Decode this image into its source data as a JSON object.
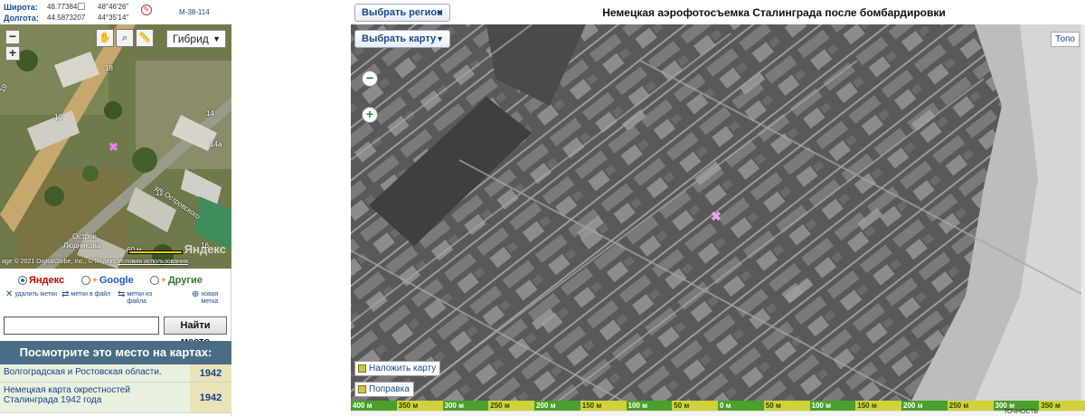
{
  "coords": {
    "lat_label": "Широта:",
    "lat_decimal": "48.7738481",
    "lat_dms": "48°46'26\"",
    "lon_label": "Долгота:",
    "lon_decimal": "44.5873207",
    "lon_dms": "44°35'14\"",
    "sheet": "M-38-114"
  },
  "minimap": {
    "layer": "Гибрид",
    "copyright": "age © 2021 DigitalGlobe, Inc., © Яндекс",
    "terms_link": "Условия использования",
    "scale_label": "60 м",
    "watermark": "Яндекс",
    "street_labels": [
      "ул. Островского",
      "Остров",
      "Людникова"
    ],
    "building_numbers": [
      "19",
      "18",
      "14",
      "14а",
      "12",
      "16",
      "10"
    ]
  },
  "providers": [
    {
      "label": "Яндекс",
      "selected": true
    },
    {
      "label": "Google",
      "selected": false
    },
    {
      "label": "Другие",
      "selected": false
    }
  ],
  "tools": [
    {
      "label": "удалить метки",
      "icon": "delete-marks-icon"
    },
    {
      "label": "метки в файл",
      "icon": "save-marks-icon"
    },
    {
      "label": "метки из файла",
      "icon": "load-marks-icon"
    },
    {
      "label": "новая метка",
      "icon": "new-mark-icon"
    }
  ],
  "search": {
    "value": "",
    "button": "Найти место"
  },
  "see_on_maps": {
    "header": "Посмотрите это место на картах:",
    "items": [
      {
        "name": "Волгоградская и Ростовская области.",
        "year": "1942"
      },
      {
        "name": "Немецкая карта окрестностей Сталинграда 1942 года",
        "year": "1942"
      }
    ]
  },
  "right": {
    "region_button": "Выбрать регион",
    "map_button": "Выбрать карту",
    "title": "Немецкая аэрофотосъемка Сталинграда после бомбардировки",
    "topo_button": "Топо",
    "overlay_button": "Наложить карту",
    "correction_button": "Поправка",
    "scale_segments": [
      "400 м",
      "350 м",
      "300 м",
      "250 м",
      "200 м",
      "150 м",
      "100 м",
      "50 м",
      "0 м",
      "50 м",
      "100 м",
      "150 м",
      "200 м",
      "250 м",
      "300 м",
      "350 м"
    ],
    "bottom_text": "ТОЧНОСТЬ"
  },
  "colors": {
    "accent_blue": "#1a4a8a",
    "header_bar": "#4a6d86",
    "scale_green": "#4aa02a",
    "scale_yellow": "#cfd23a"
  }
}
